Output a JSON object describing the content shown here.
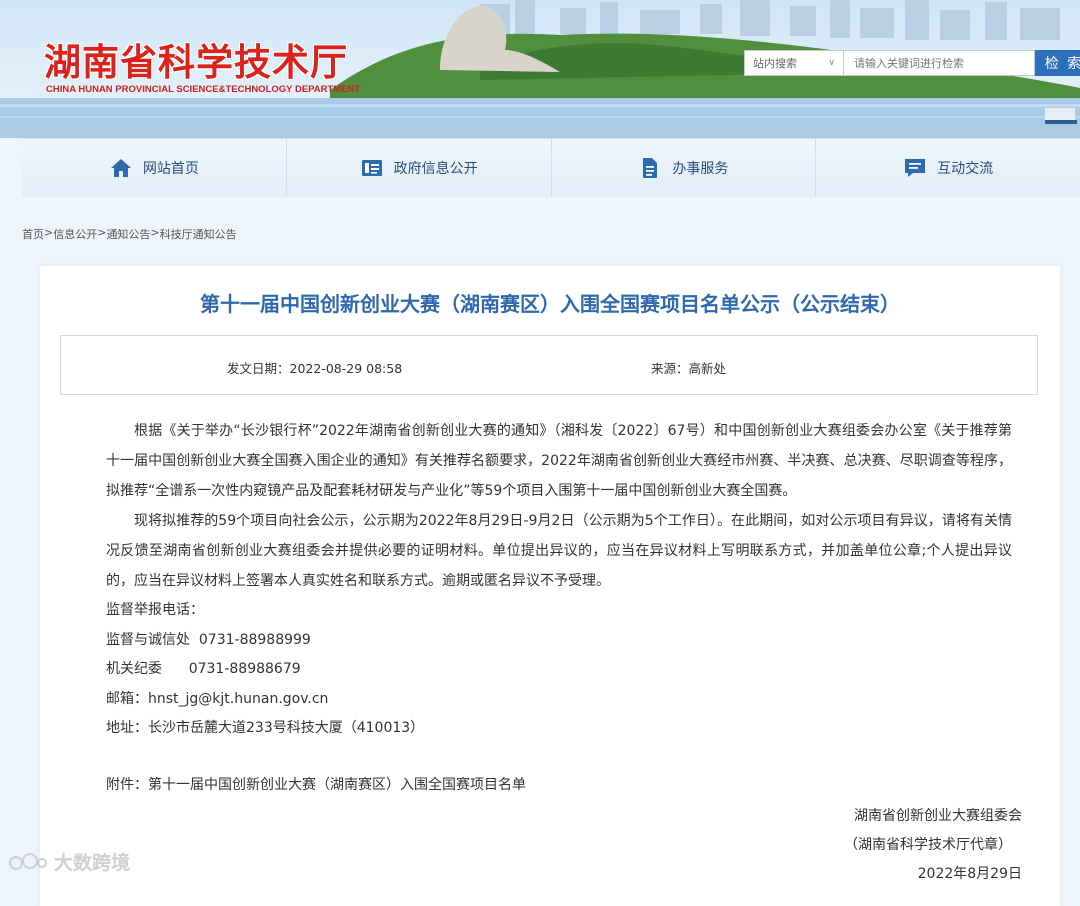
{
  "header": {
    "title": "湖南省科学技术厅",
    "subtitle": "CHINA HUNAN PROVINCIAL SCIENCE&TECHNOLOGY DEPARTMENT",
    "search_scope": "站内搜索",
    "search_placeholder": "请输入关键词进行检索",
    "search_button": "检 索"
  },
  "nav": {
    "items": [
      {
        "label": "网站首页",
        "icon": "home-icon"
      },
      {
        "label": "政府信息公开",
        "icon": "info-card-icon"
      },
      {
        "label": "办事服务",
        "icon": "document-icon"
      },
      {
        "label": "互动交流",
        "icon": "chat-icon"
      }
    ]
  },
  "breadcrumb": [
    "首页",
    "信息公开",
    "通知公告",
    "科技厅通知公告"
  ],
  "article": {
    "title": "第十一届中国创新创业大赛（湖南赛区）入围全国赛项目名单公示（公示结束）",
    "date_label": "发文日期：2022-08-29 08:58",
    "source_label": "来源：高新处",
    "paragraphs": [
      "根据《关于举办“长沙银行杯”2022年湖南省创新创业大赛的通知》（湘科发〔2022〕67号）和中国创新创业大赛组委会办公室《关于推荐第十一届中国创新创业大赛全国赛入围企业的通知》有关推荐名额要求，2022年湖南省创新创业大赛经市州赛、半决赛、总决赛、尽职调查等程序，拟推荐“全谱系一次性内窥镜产品及配套耗材研发与产业化”等59个项目入围第十一届中国创新创业大赛全国赛。",
      "现将拟推荐的59个项目向社会公示，公示期为2022年8月29日-9月2日（公示期为5个工作日）。在此期间，如对公示项目有异议，请将有关情况反馈至湖南省创新创业大赛组委会并提供必要的证明材料。单位提出异议的，应当在异议材料上写明联系方式，并加盖单位公章;个人提出异议的，应当在异议材料上签署本人真实姓名和联系方式。逾期或匿名异议不予受理。"
    ],
    "contacts": [
      "监督举报电话：",
      "监督与诚信处  0731-88988999",
      "机关纪委      0731-88988679",
      "邮箱：hnst_jg@kjt.hunan.gov.cn",
      "地址：长沙市岳麓大道233号科技大厦（410013）"
    ],
    "attachment": "附件：第十一届中国创新创业大赛（湖南赛区）入围全国赛项目名单",
    "signature": [
      "湖南省创新创业大赛组委会",
      "（湖南省科学技术厅代章）",
      "2022年8月29日"
    ]
  },
  "watermark": "大数跨境"
}
